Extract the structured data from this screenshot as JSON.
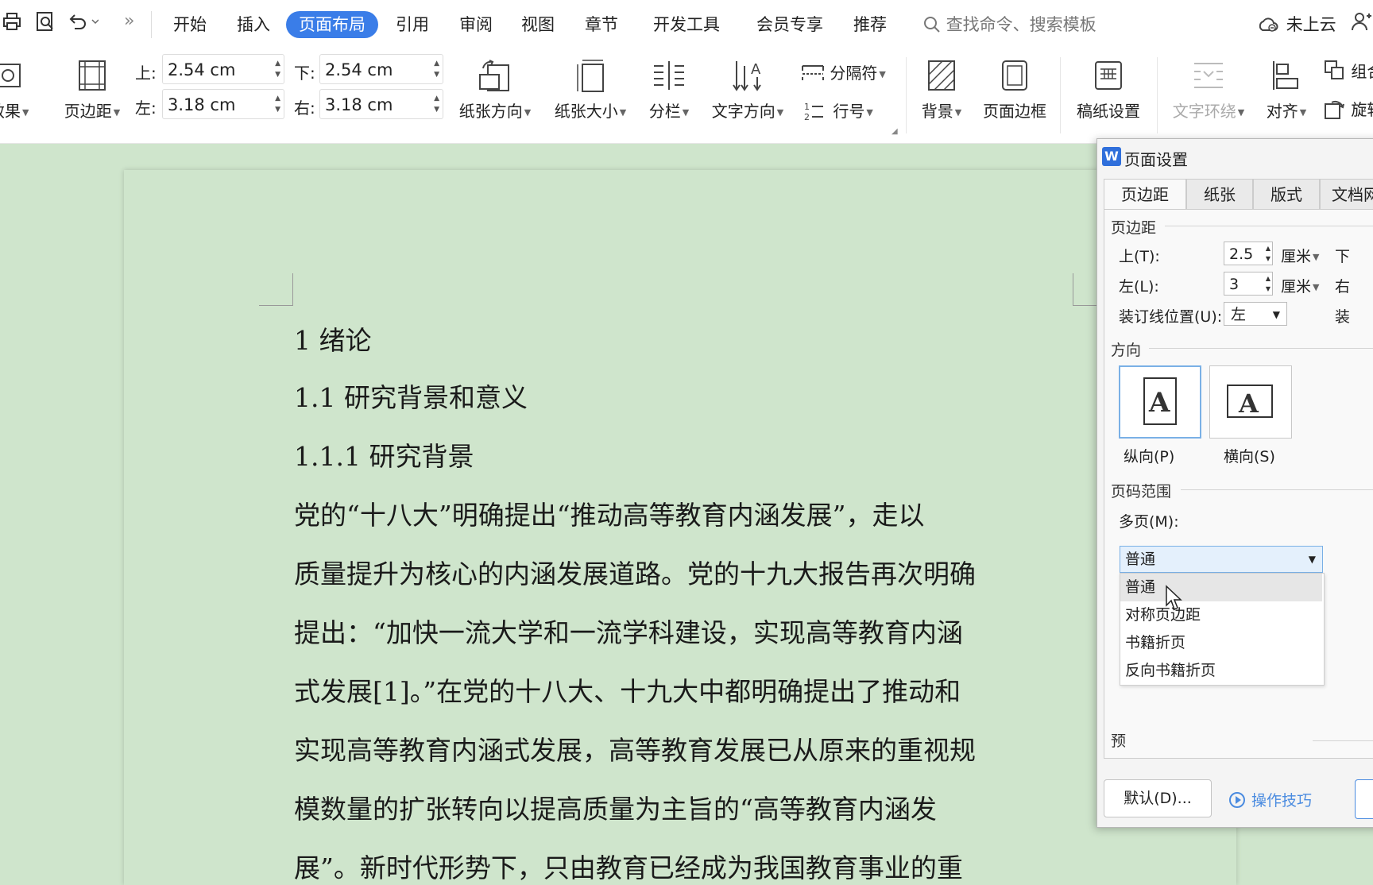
{
  "menubar": {
    "tabs": [
      {
        "label": "开始",
        "active": false
      },
      {
        "label": "插入",
        "active": false
      },
      {
        "label": "页面布局",
        "active": true
      },
      {
        "label": "引用",
        "active": false
      },
      {
        "label": "审阅",
        "active": false
      },
      {
        "label": "视图",
        "active": false
      },
      {
        "label": "章节",
        "active": false
      },
      {
        "label": "开发工具",
        "active": false
      },
      {
        "label": "会员专享",
        "active": false
      },
      {
        "label": "推荐",
        "active": false
      }
    ],
    "search_placeholder": "查找命令、搜索模板",
    "cloud_status": "未上云",
    "more_glyph": "»"
  },
  "ribbon": {
    "effect_label": "效果",
    "margins_label": "页边距",
    "margin_top_label": "上:",
    "margin_top": "2.54 cm",
    "margin_bottom_label": "下:",
    "margin_bottom": "2.54 cm",
    "margin_left_label": "左:",
    "margin_left": "3.18 cm",
    "margin_right_label": "右:",
    "margin_right": "3.18 cm",
    "orientation_label": "纸张方向",
    "size_label": "纸张大小",
    "columns_label": "分栏",
    "text_direction_label": "文字方向",
    "separator_label": "分隔符",
    "line_number_label": "行号",
    "background_label": "背景",
    "page_border_label": "页面边框",
    "manuscript_label": "稿纸设置",
    "text_wrap_label": "文字环绕",
    "align_label": "对齐",
    "group_label": "组合",
    "rotate_label": "旋转"
  },
  "document": {
    "lines": [
      "1 绪论",
      "1.1 研究背景和意义",
      "1.1.1  研究背景",
      "党的“十八大”明确提出“推动高等教育内涵发展”，走以",
      "质量提升为核心的内涵发展道路。党的十九大报告再次明确",
      "提出：“加快一流大学和一流学科建设，实现高等教育内涵",
      "式发展[1]。”在党的十八大、十九大中都明确提出了推动和",
      "实现高等教育内涵式发展，高等教育发展已从原来的重视规",
      "模数量的扩张转向以提高质量为主旨的“高等教育内涵发",
      "展”。新时代形势下，只由教育已经成为我国教育事业的重"
    ]
  },
  "dialog": {
    "title": "页面设置",
    "tabs": [
      "页边距",
      "纸张",
      "版式",
      "文档网格"
    ],
    "margins_group": "页边距",
    "top_label": "上(T):",
    "top_value": "2.5",
    "left_label": "左(L):",
    "left_value": "3",
    "unit": "厘米",
    "bottom_label_partial": "下",
    "right_label_partial": "右",
    "gutter_partial": "装",
    "gutter_label": "装订线位置(U):",
    "gutter_value": "左",
    "orientation_group": "方向",
    "portrait_label": "纵向(P)",
    "landscape_label": "横向(S)",
    "page_range_group": "页码范围",
    "multi_label": "多页(M):",
    "multi_value": "普通",
    "preview_partial": "预",
    "dropdown_options": [
      "普通",
      "对称页边距",
      "书籍折页",
      "反向书籍折页"
    ],
    "default_button": "默认(D)...",
    "tips_link": "操作技巧"
  }
}
